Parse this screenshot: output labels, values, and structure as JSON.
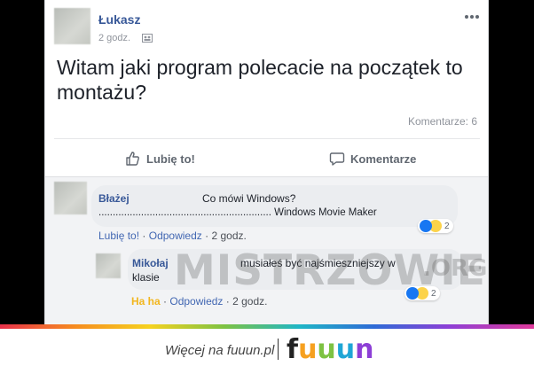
{
  "post": {
    "author": "Łukasz",
    "time": "2 godz.",
    "text": "Witam jaki program polecacie na początek to montażu?",
    "comments_count": "Komentarze: 6"
  },
  "actions": {
    "like": "Lubię to!",
    "comment": "Komentarze"
  },
  "comments": [
    {
      "author": "Błażej",
      "text_line1": "Co mówi Windows?",
      "text_line2": "............................................................. Windows Movie Maker",
      "like_label": "Lubię to!",
      "reply_label": "Odpowiedz",
      "time": "2 godz.",
      "reaction_count": "2"
    },
    {
      "author": "Mikołaj",
      "text_line1": "musiałeś być najśmieszniejszy w",
      "text_line2": "klasie",
      "like_label": "Ha ha",
      "reply_label": "Odpowiedz",
      "time": "2 godz.",
      "reaction_count": "2"
    }
  ],
  "watermark": {
    "main": "MISTRZOWIE",
    "suffix": ".ORG"
  },
  "footer": {
    "more_text": "Więcej na fuuun.pl",
    "logo": [
      "f",
      "u",
      "u",
      "u",
      "n"
    ]
  },
  "colors": {
    "link": "#385898",
    "text": "#1d2129",
    "meta": "#90949c",
    "haha": "#f2b61f",
    "like_blue": "#1877f2"
  }
}
